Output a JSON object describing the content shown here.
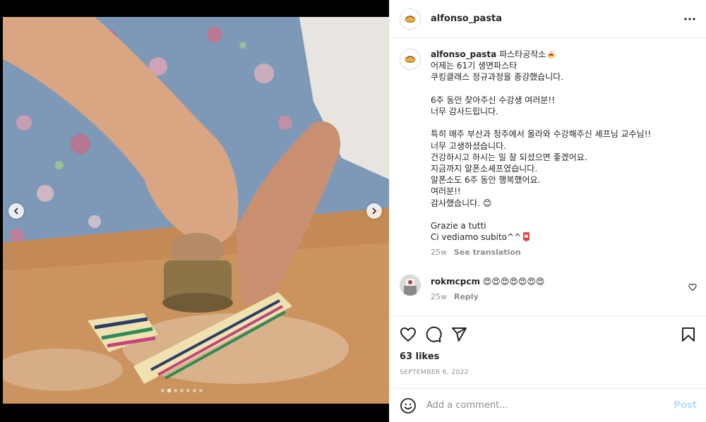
{
  "post": {
    "username": "alfonso_pasta",
    "brand_color": "#c0392b"
  },
  "caption": {
    "username": "alfonso_pasta",
    "text": "파스타공작소🍝\n어제는 61기 생면파스타\n쿠킹클래스 정규과정을 종강했습니다.\n\n6주 동안 찾아주신 수강생 여러분!!\n너무 감사드립니다.\n\n특히 매주 부산과 청주에서 올라와 수강해주신 셰프님 교수님!!\n너무 고생하셨습니다.\n건강하시고 하시는 일 잘 되셨으면 좋겠어요.\n지금까지 알폰소셰프였습니다.\n알폰소도 6주 동안 행복했어요.\n여러분!!\n감사했습니다. 😊\n\nGrazie a tutti\nCi vediamo subito^^📮",
    "time": "25w",
    "translate": "See translation"
  },
  "comments": [
    {
      "username": "rokmcpcm",
      "text": "😍😍😍😍😍😍😍",
      "time": "25w",
      "reply": "Reply"
    }
  ],
  "stats": {
    "likes": "63 likes",
    "date": "SEPTEMBER 6, 2022"
  },
  "composer": {
    "placeholder": "Add a comment...",
    "post_label": "Post"
  },
  "carousel": {
    "slide_count": 7,
    "active_slide": 1
  },
  "icons": {
    "more": "more-horizontal-icon",
    "like": "heart-icon",
    "comment": "comment-icon",
    "share": "send-icon",
    "save": "bookmark-icon",
    "emoji": "emoji-icon",
    "prev": "chevron-left-icon",
    "next": "chevron-right-icon"
  },
  "colors": {
    "link_disabled": "#b2dffc",
    "muted": "#8e8e8e",
    "text": "#262626"
  }
}
